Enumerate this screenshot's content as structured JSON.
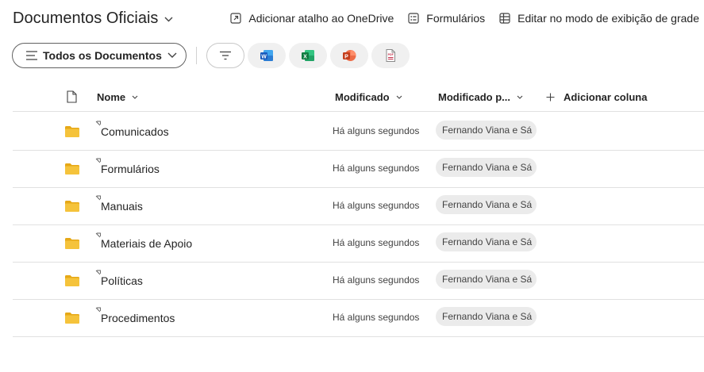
{
  "library": {
    "title": "Documentos Oficiais"
  },
  "actions": [
    {
      "label": "Adicionar atalho ao OneDrive",
      "icon": "shortcut-icon"
    },
    {
      "label": "Formulários",
      "icon": "forms-icon"
    },
    {
      "label": "Editar no modo de exibição de grade",
      "icon": "grid-icon"
    }
  ],
  "toolbar": {
    "view_label": "Todos os Documentos",
    "filter_icon": "filter-icon",
    "new_buttons": [
      {
        "icon": "word-icon",
        "letter": "W",
        "color": "#185abd"
      },
      {
        "icon": "excel-icon",
        "letter": "X",
        "color": "#107c41"
      },
      {
        "icon": "powerpoint-icon",
        "letter": "P",
        "color": "#c43e1c"
      },
      {
        "icon": "pdf-icon",
        "letter": "PDF",
        "color": "#c4314b"
      }
    ]
  },
  "columns": {
    "name": "Nome",
    "modified": "Modificado",
    "modified_by": "Modificado p...",
    "add_column": "Adicionar coluna"
  },
  "rows": [
    {
      "name": "Comunicados",
      "modified": "Há alguns segundos",
      "modified_by": "Fernando Viana e Sá"
    },
    {
      "name": "Formulários",
      "modified": "Há alguns segundos",
      "modified_by": "Fernando Viana e Sá"
    },
    {
      "name": "Manuais",
      "modified": "Há alguns segundos",
      "modified_by": "Fernando Viana e Sá"
    },
    {
      "name": "Materiais de Apoio",
      "modified": "Há alguns segundos",
      "modified_by": "Fernando Viana e Sá"
    },
    {
      "name": "Políticas",
      "modified": "Há alguns segundos",
      "modified_by": "Fernando Viana e Sá"
    },
    {
      "name": "Procedimentos",
      "modified": "Há alguns segundos",
      "modified_by": "Fernando Viana e Sá"
    }
  ],
  "colors": {
    "folder": "#f5c33b",
    "folder_back": "#e6a817",
    "badge_bg": "#ebebeb",
    "divider": "#e1e1e1"
  }
}
